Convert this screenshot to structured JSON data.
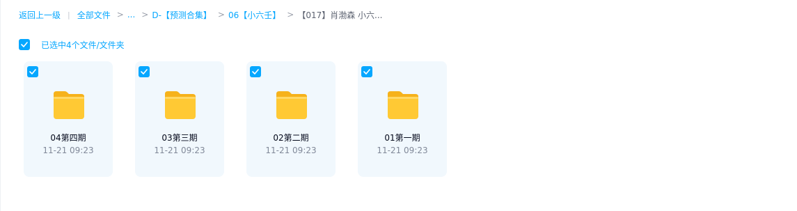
{
  "breadcrumb": {
    "back": "返回上一级",
    "items": [
      {
        "label": "全部文件"
      },
      {
        "label": "..."
      },
      {
        "label": "D-【预测合集】"
      },
      {
        "label": "06【小六壬】"
      },
      {
        "label": "【017】肖渤森 小六..."
      }
    ]
  },
  "selection": {
    "text": "已选中4个文件/文件夹"
  },
  "files": [
    {
      "name": "04第四期",
      "date": "11-21 09:23"
    },
    {
      "name": "03第三期",
      "date": "11-21 09:23"
    },
    {
      "name": "02第二期",
      "date": "11-21 09:23"
    },
    {
      "name": "01第一期",
      "date": "11-21 09:23"
    }
  ],
  "colors": {
    "accent": "#06a7ff",
    "card_bg": "#f1f8fd",
    "folder": "#ffc934"
  }
}
